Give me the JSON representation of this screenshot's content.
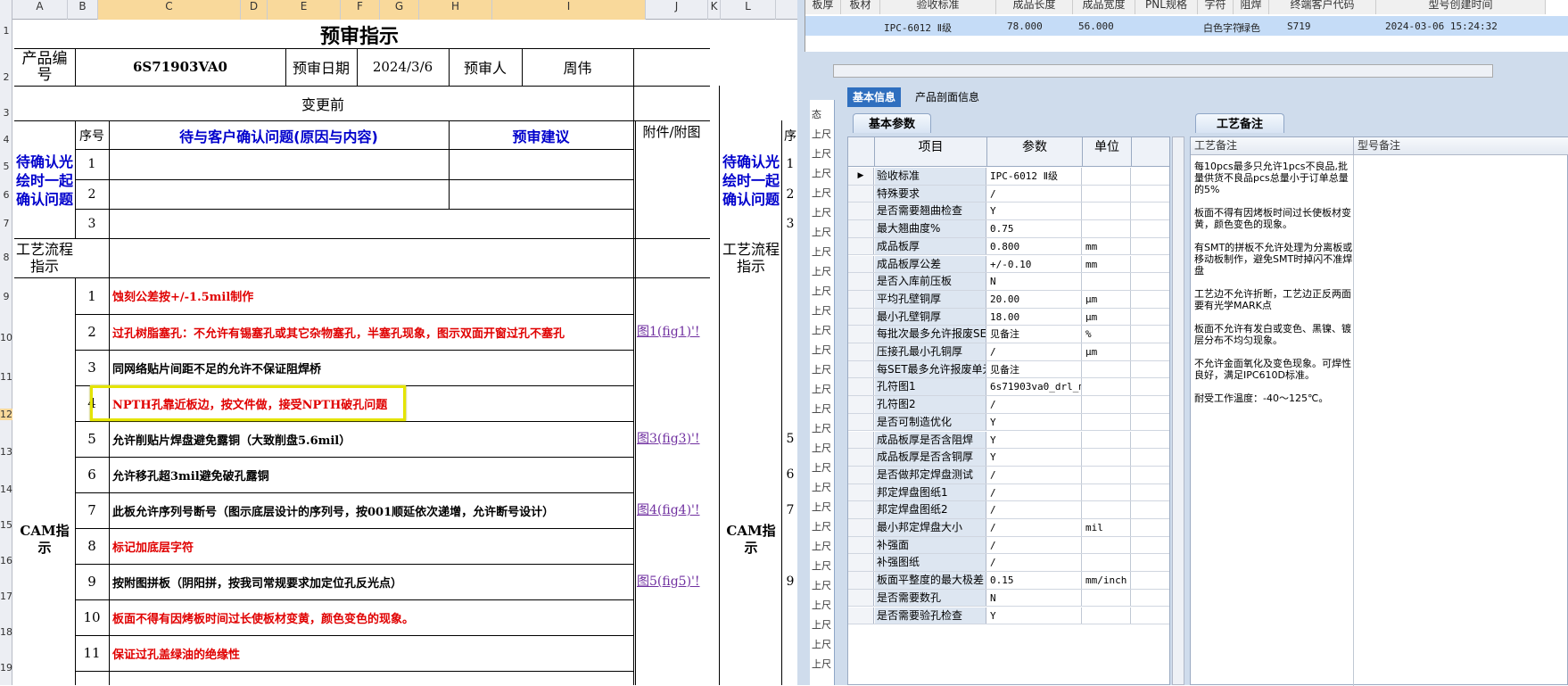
{
  "sheet": {
    "col_headers": [
      "A",
      "B",
      "C",
      "D",
      "E",
      "F",
      "G",
      "H",
      "I",
      "J",
      "K",
      "L"
    ],
    "row_headers": [
      "1",
      "2",
      "3",
      "4",
      "5",
      "6",
      "7",
      "8",
      "9",
      "10",
      "11",
      "12",
      "13",
      "14",
      "15",
      "16",
      "17",
      "18",
      "19"
    ],
    "title": "预审指示",
    "product_no_label": "产品编号",
    "product_no": "6S71903VA0",
    "review_date_label": "预审日期",
    "review_date": "2024/3/6",
    "reviewer_label": "预审人",
    "reviewer": "周伟",
    "before_change": "变更前",
    "confirm_label": "待确认光绘时一起确认问题",
    "seq_header": "序号",
    "issue_header": "待与客户确认问题(原因与内容)",
    "suggestion_header": "预审建议",
    "attach_header": "附件/附图",
    "seq_rows": [
      "1",
      "2",
      "3"
    ],
    "process_label": "工艺流程指示",
    "cam_label": "CAM指示",
    "items": [
      {
        "n": "1",
        "text": "蚀刻公差按+/-1.5mil制作",
        "color": "red",
        "link": ""
      },
      {
        "n": "2",
        "text": "过孔树脂塞孔：不允许有锡塞孔或其它杂物塞孔，半塞孔现象，图示双面开窗过孔不塞孔",
        "color": "red",
        "link": "图1(fig1)'!"
      },
      {
        "n": "3",
        "text": "同网络贴片间距不足的允许不保证阻焊桥",
        "color": "black",
        "link": ""
      },
      {
        "n": "4",
        "text": "NPTH孔靠近板边，按文件做，接受NPTH破孔问题",
        "color": "red",
        "link": ""
      },
      {
        "n": "5",
        "text": "允许削贴片焊盘避免露铜（大致削盘5.6mil）",
        "color": "black",
        "link": "图3(fig3)'!"
      },
      {
        "n": "6",
        "text": "允许移孔超3mil避免破孔露铜",
        "color": "black",
        "link": ""
      },
      {
        "n": "7",
        "text": "此板允许序列号断号（图示底层设计的序列号，按001顺延依次递增，允许断号设计）",
        "color": "black",
        "link": "图4(fig4)'!"
      },
      {
        "n": "8",
        "text": "标记加底层字符",
        "color": "red",
        "link": ""
      },
      {
        "n": "9",
        "text": "按附图拼板（阴阳拼，按我司常规要求加定位孔反光点）",
        "color": "black",
        "link": "图5(fig5)'!"
      },
      {
        "n": "10",
        "text": "板面不得有因烤板时间过长使板材变黄，颜色变色的现象。",
        "color": "red",
        "link": ""
      },
      {
        "n": "11",
        "text": "保证过孔盖绿油的绝缘性",
        "color": "red",
        "link": ""
      }
    ],
    "right_seq_header": "序",
    "right_items": [
      "1",
      "2",
      "3",
      "5",
      "6",
      "7",
      "9"
    ]
  },
  "app": {
    "top_headers": [
      "板厚",
      "板材",
      "验收标准",
      "成品长度",
      "成品宽度",
      "PNL规格",
      "字符",
      "阻焊",
      "终端客户代码",
      "型号创建时间"
    ],
    "top_row": {
      "standard": "IPC-6012 Ⅱ级",
      "length": "78.000",
      "width": "56.000",
      "silk": "白色字符",
      "mask": "绿色",
      "customer": "S719",
      "created": "2024-03-06 15:24:32"
    },
    "left_stripe_items": [
      "态",
      "上尺",
      "上尺",
      "上尺",
      "上尺",
      "上尺",
      "上尺",
      "上尺",
      "上尺",
      "上尺",
      "上尺",
      "上尺",
      "上尺",
      "上尺",
      "上尺",
      "上尺",
      "上尺",
      "上尺",
      "上尺",
      "上尺",
      "上尺",
      "上尺",
      "上尺",
      "上尺",
      "上尺",
      "上尺",
      "上尺",
      "上尺",
      "上尺",
      "上尺"
    ],
    "tabs": [
      "基本信息",
      "产品剖面信息"
    ],
    "subtabs": {
      "basic": "基本参数",
      "process": "工艺备注"
    },
    "grid_headers": [
      "项目",
      "参数",
      "单位"
    ],
    "grid_rows": [
      {
        "k": "验收标准",
        "v": "IPC-6012 Ⅱ级",
        "u": ""
      },
      {
        "k": "特殊要求",
        "v": "/",
        "u": ""
      },
      {
        "k": "是否需要翘曲检查",
        "v": "Y",
        "u": ""
      },
      {
        "k": "最大翘曲度%",
        "v": "0.75",
        "u": ""
      },
      {
        "k": "成品板厚",
        "v": "0.800",
        "u": "mm"
      },
      {
        "k": "成品板厚公差",
        "v": "+/-0.10",
        "u": "mm"
      },
      {
        "k": "是否入库前压板",
        "v": "N",
        "u": ""
      },
      {
        "k": "平均孔壁铜厚",
        "v": "20.00",
        "u": "μm"
      },
      {
        "k": "最小孔壁铜厚",
        "v": "18.00",
        "u": "μm"
      },
      {
        "k": "每批次最多允许报废SET",
        "v": "见备注",
        "u": "%"
      },
      {
        "k": "压接孔最小孔铜厚",
        "v": "/",
        "u": "μm"
      },
      {
        "k": "每SET最多允许报废单元",
        "v": "见备注",
        "u": ""
      },
      {
        "k": "孔符图1",
        "v": "6s71903va0_drl_m...",
        "u": ""
      },
      {
        "k": "孔符图2",
        "v": "/",
        "u": ""
      },
      {
        "k": "是否可制造优化",
        "v": "Y",
        "u": ""
      },
      {
        "k": "成品板厚是否含阻焊",
        "v": "Y",
        "u": ""
      },
      {
        "k": "成品板厚是否含铜厚",
        "v": "Y",
        "u": ""
      },
      {
        "k": "是否做邦定焊盘测试",
        "v": "/",
        "u": ""
      },
      {
        "k": "邦定焊盘图纸1",
        "v": "/",
        "u": ""
      },
      {
        "k": "邦定焊盘图纸2",
        "v": "/",
        "u": ""
      },
      {
        "k": "最小邦定焊盘大小",
        "v": "/",
        "u": "mil"
      },
      {
        "k": "补强面",
        "v": "/",
        "u": ""
      },
      {
        "k": "补强图纸",
        "v": "/",
        "u": ""
      },
      {
        "k": "板面平整度的最大极差",
        "v": "0.15",
        "u": "mm/inch"
      },
      {
        "k": "是否需要数孔",
        "v": "N",
        "u": ""
      },
      {
        "k": "是否需要验孔检查",
        "v": "Y",
        "u": ""
      }
    ],
    "notes_header": "工艺备注",
    "model_notes_header": "型号备注",
    "notes": [
      "每10pcs最多只允许1pcs不良品,批量供货不良品pcs总量小于订单总量的5%",
      "板面不得有因烤板时间过长使板材变黄，颜色变色的现象。",
      "有SMT的拼板不允许处理为分离板或移动板制作，避免SMT时掉闪不准焊盘",
      "工艺边不允许折断，工艺边正反两面要有光学MARK点",
      "板面不允许有发白或变色、黑镍、镀层分布不均匀现象。",
      "不允许金面氧化及变色现象。可焊性良好，满足IPC610D标准。",
      "耐受工作温度：-40～125℃。"
    ]
  }
}
